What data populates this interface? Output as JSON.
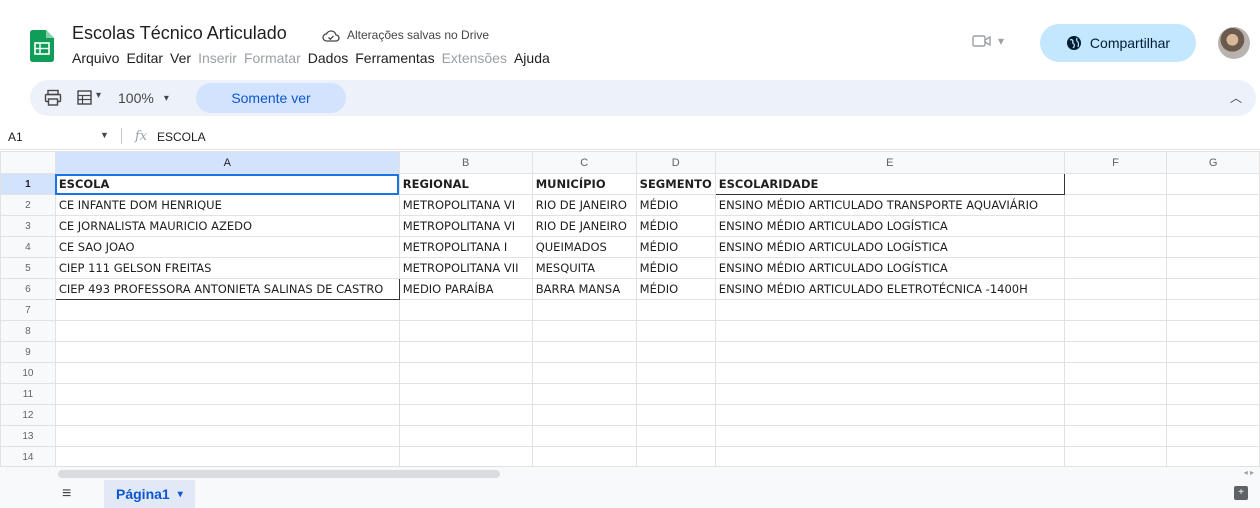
{
  "header": {
    "title": "Escolas Técnico Articulado",
    "save_status": "Alterações salvas no Drive",
    "menu": [
      {
        "label": "Arquivo",
        "disabled": false
      },
      {
        "label": "Editar",
        "disabled": false
      },
      {
        "label": "Ver",
        "disabled": false
      },
      {
        "label": "Inserir",
        "disabled": true
      },
      {
        "label": "Formatar",
        "disabled": true
      },
      {
        "label": "Dados",
        "disabled": false
      },
      {
        "label": "Ferramentas",
        "disabled": false
      },
      {
        "label": "Extensões",
        "disabled": true
      },
      {
        "label": "Ajuda",
        "disabled": false
      }
    ],
    "share_label": "Compartilhar"
  },
  "toolbar": {
    "zoom": "100%",
    "mode_label": "Somente ver"
  },
  "formula_bar": {
    "cell_ref": "A1",
    "fx_label": "fx",
    "content": "ESCOLA"
  },
  "grid": {
    "columns": [
      "A",
      "B",
      "C",
      "D",
      "E",
      "F",
      "G"
    ],
    "selected_column": "A",
    "row_numbers": [
      "1",
      "2",
      "3",
      "4",
      "5",
      "6",
      "7",
      "8",
      "9",
      "10",
      "11",
      "12",
      "13",
      "14"
    ],
    "rows": [
      [
        "ESCOLA",
        "REGIONAL",
        "MUNICÍPIO",
        "SEGMENTO",
        "ESCOLARIDADE",
        "",
        ""
      ],
      [
        "CE INFANTE DOM HENRIQUE",
        "METROPOLITANA VI",
        "RIO DE JANEIRO",
        "MÉDIO",
        "ENSINO MÉDIO ARTICULADO TRANSPORTE AQUAVIÁRIO",
        "",
        ""
      ],
      [
        "CE JORNALISTA MAURICIO AZEDO",
        "METROPOLITANA VI",
        "RIO DE JANEIRO",
        "MÉDIO",
        "ENSINO MÉDIO ARTICULADO LOGÍSTICA",
        "",
        ""
      ],
      [
        "CE SAO JOAO",
        "METROPOLITANA I",
        "QUEIMADOS",
        "MÉDIO",
        "ENSINO MÉDIO ARTICULADO LOGÍSTICA",
        "",
        ""
      ],
      [
        "CIEP 111 GELSON FREITAS",
        "METROPOLITANA VII",
        "MESQUITA",
        "MÉDIO",
        "ENSINO MÉDIO ARTICULADO LOGÍSTICA",
        "",
        ""
      ],
      [
        "CIEP 493 PROFESSORA ANTONIETA SALINAS DE CASTRO",
        "MEDIO PARAÍBA",
        "BARRA MANSA",
        "MÉDIO",
        "ENSINO MÉDIO ARTICULADO ELETROTÉCNICA -1400H",
        "",
        ""
      ]
    ]
  },
  "sheets": [
    {
      "label": "Página1",
      "active": true
    }
  ],
  "icons": {
    "logo": "google-sheets-icon",
    "cloud": "cloud-done-icon",
    "meet": "video-camera-icon",
    "share": "globe-icon",
    "print": "print-icon",
    "format": "paint-format-icon",
    "collapse": "chevron-up-icon",
    "all_sheets": "menu-icon",
    "explore": "explore-icon"
  },
  "colors": {
    "share_bg": "#c2e7ff",
    "toolbar_bg": "#edf2fa",
    "selection": "#1a73e8",
    "logo_green": "#0f9d58"
  }
}
